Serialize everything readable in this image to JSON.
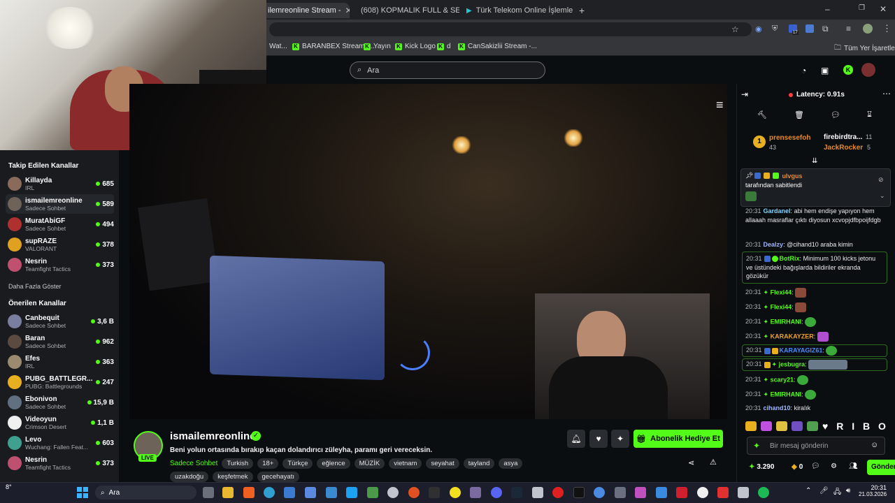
{
  "browser": {
    "tabs": [
      {
        "label": "ilemreonline Stream - ",
        "active": true
      },
      {
        "label": "(608) KOPMALIK FULL & SET 8",
        "active": false
      },
      {
        "label": "Türk Telekom Online İşlemler",
        "active": false
      }
    ],
    "new_tab": "+",
    "window_controls": [
      "–",
      "❐",
      "✕"
    ],
    "bookmarks": [
      {
        "label": "Wat..."
      },
      {
        "label": "BARANBEX Stream -..."
      },
      {
        "label": "Yayın"
      },
      {
        "label": "Kick Logo"
      },
      {
        "label": "d"
      },
      {
        "label": "CanSakizlii Stream -..."
      }
    ],
    "bookmarks_all": "Tüm Yer İşaretleri",
    "ext_badge": "17"
  },
  "kick": {
    "search_placeholder": "Ara"
  },
  "sidebar": {
    "followed_title": "Takip Edilen Kanallar",
    "followed": [
      {
        "name": "Killayda",
        "category": "IRL",
        "viewers": "685",
        "color": "#8a6a5a"
      },
      {
        "name": "ismailemreonline",
        "category": "Sadece Sohbet",
        "viewers": "589",
        "color": "#6d6358",
        "selected": true
      },
      {
        "name": "MuratAbiGF",
        "category": "Sadece Sohbet",
        "viewers": "494",
        "color": "#b03030"
      },
      {
        "name": "supRAZE",
        "category": "VALORANT",
        "viewers": "378",
        "color": "#e0a020"
      },
      {
        "name": "Nesrin",
        "category": "Teamfight Tactics",
        "viewers": "373",
        "color": "#c05070"
      }
    ],
    "show_more": "Daha Fazla Göster",
    "recommended_title": "Önerilen Kanallar",
    "recommended": [
      {
        "name": "Canbequit",
        "category": "Sadece Sohbet",
        "viewers": "3,6 B",
        "color": "#7a7fa0"
      },
      {
        "name": "Baran",
        "category": "Sadece Sohbet",
        "viewers": "962",
        "color": "#5a4a40"
      },
      {
        "name": "Efes",
        "category": "IRL",
        "viewers": "363",
        "color": "#9a8a70"
      },
      {
        "name": "PUBG_BATTLEGR...",
        "category": "PUBG: Battlegrounds",
        "viewers": "247",
        "color": "#e8b020"
      },
      {
        "name": "Ebonivon",
        "category": "Sadece Sohbet",
        "viewers": "15,9 B",
        "color": "#607080"
      },
      {
        "name": "Videoyun",
        "category": "Crimson Desert",
        "viewers": "1,1 B",
        "color": "#f0f0f0"
      },
      {
        "name": "Levo",
        "category": "Wuchang: Fallen Feat...",
        "viewers": "603",
        "color": "#40a090"
      },
      {
        "name": "Nesrin",
        "category": "Teamfight Tactics",
        "viewers": "373",
        "color": "#c05070"
      }
    ]
  },
  "stream": {
    "channel": "ismailemreonline",
    "live": "LIVE",
    "title": "Beni yolun ortasında bırakıp kaçan dolandırıcı züleyha, paramı geri vereceksin.",
    "category": "Sadece Sohbet",
    "tags_row1": [
      "Turkish",
      "18+",
      "Türkçe",
      "eğlence",
      "MÜZİK",
      "vietnam",
      "seyahat",
      "tayland",
      "asya"
    ],
    "tags_row2": [
      "uzakdoğu",
      "keşfetmek",
      "gecehayatı"
    ],
    "gift_button": "Abonelik Hediye Et"
  },
  "chat": {
    "latency": "Latency: 0.91s",
    "leaderboard": [
      {
        "rank": "1",
        "name": "prensesefoh",
        "count": "43",
        "color": "#e88a2a"
      },
      {
        "name": "firebirdtra...",
        "count": "11",
        "color": "#ffffff"
      },
      {
        "name": "JackRocker",
        "count": "5",
        "color": "#e88a2a"
      }
    ],
    "pinned_user": "ulvgus",
    "pinned_text": "tarafından sabitlendi",
    "messages": [
      {
        "time": "20:31",
        "user": "Gardanel",
        "color": "#7fd3ff",
        "text": "abi hem endişe yapıyon hem allaaah masraflar çıktı diyosun xcvopjdfbpoijfdgb"
      },
      {
        "time": "20:31",
        "user": "Dealzy",
        "color": "#9fb4ff",
        "text": "@cihand10 araba kimin"
      },
      {
        "time": "20:31",
        "user": "BotRix",
        "color": "#53fc18",
        "text": "Minimum 100 kicks jetonu ve üstündeki bağışlarda bildiriler ekranda gözükür"
      },
      {
        "time": "20:31",
        "user": "Flexi44",
        "color": "#53fc18",
        "text": ""
      },
      {
        "time": "20:31",
        "user": "Flexi44",
        "color": "#53fc18",
        "text": ""
      },
      {
        "time": "20:31",
        "user": "EMIRHANI",
        "color": "#53fc18",
        "text": ""
      },
      {
        "time": "20:31",
        "user": "KARAKAYZER",
        "color": "#e8a030",
        "text": ""
      },
      {
        "time": "20:31",
        "user": "KARAYAGIZ61",
        "color": "#4a8cff",
        "text": ""
      },
      {
        "time": "20:31",
        "user": "jesbugra",
        "color": "#53fc18",
        "text": ""
      },
      {
        "time": "20:31",
        "user": "scary21",
        "color": "#53fc18",
        "text": ""
      },
      {
        "time": "20:31",
        "user": "EMIRHANI",
        "color": "#53fc18",
        "text": ""
      },
      {
        "time": "20:31",
        "user": "cihand10",
        "color": "#9fb4ff",
        "text": "kiralık"
      }
    ],
    "emote_strip_text": "♥ R I B O",
    "input_placeholder": "Bir mesaj gönderin",
    "points": "3.290",
    "zero": "0",
    "send": "Gönder"
  },
  "taskbar": {
    "temp": "8°",
    "search": "Ara",
    "time": "20:31",
    "date": "21.03.2026"
  }
}
